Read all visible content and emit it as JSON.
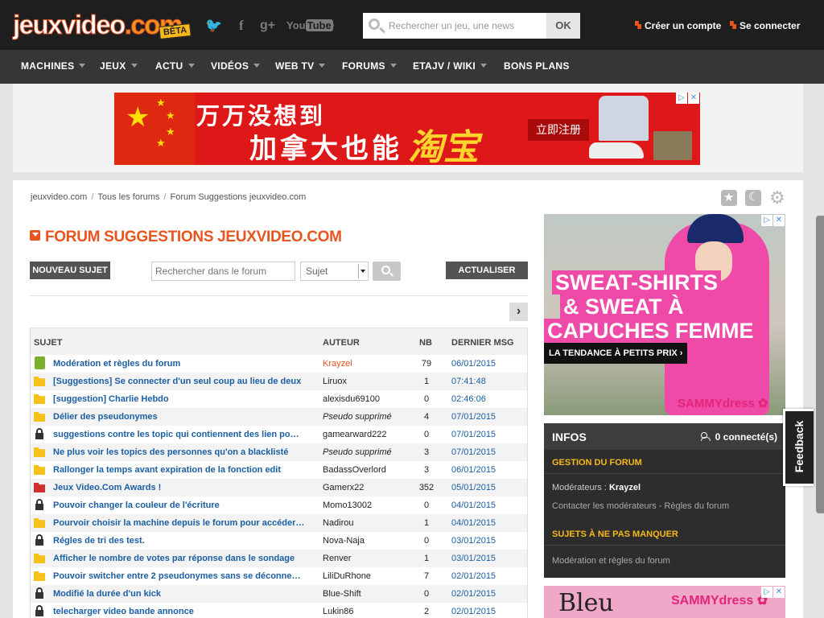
{
  "header": {
    "logo_main": "jeuxvideo",
    "logo_tld": ".com",
    "logo_badge": "BÊTA",
    "social": [
      {
        "icon": "twitter-icon",
        "glyph": "🐦"
      },
      {
        "icon": "facebook-icon",
        "glyph": "f"
      },
      {
        "icon": "googleplus-icon",
        "glyph": "g+"
      },
      {
        "icon": "youtube-icon",
        "glyph": "You"
      },
      {
        "icon": "rss-icon",
        "glyph": "◝"
      }
    ],
    "search_placeholder": "Rechercher un jeu, une news",
    "search_button": "OK",
    "create_account": "Créer un compte",
    "login": "Se connecter"
  },
  "nav": {
    "items": [
      {
        "label": "MACHINES",
        "dropdown": true
      },
      {
        "label": "JEUX",
        "dropdown": true
      },
      {
        "label": "ACTU",
        "dropdown": true
      },
      {
        "label": "VIDÉOS",
        "dropdown": true
      },
      {
        "label": "WEB TV",
        "dropdown": true
      },
      {
        "label": "FORUMS",
        "dropdown": true
      },
      {
        "label": "ETAJV / WIKI",
        "dropdown": true
      },
      {
        "label": "BONS PLANS",
        "dropdown": false
      }
    ]
  },
  "top_ad": {
    "line1": "万万没想到",
    "line2": "加拿大也能",
    "highlight": "淘宝",
    "button": "立即注册"
  },
  "breadcrumb": {
    "items": [
      "jeuxvideo.com",
      "Tous les forums",
      "Forum Suggestions jeuxvideo.com"
    ]
  },
  "forum": {
    "title": "FORUM SUGGESTIONS JEUXVIDEO.COM",
    "new_topic_button": "NOUVEAU SUJET",
    "search_placeholder": "Rechercher dans le forum",
    "search_scope": "Sujet",
    "refresh_button": "ACTUALISER",
    "next_page": "›",
    "columns": {
      "subject": "SUJET",
      "author": "AUTEUR",
      "count": "NB",
      "last": "DERNIER MSG"
    },
    "topics": [
      {
        "icon": "pin",
        "title": "Modération et règles du forum",
        "author": "Krayzel",
        "author_style": "mod",
        "count": "79",
        "last": "06/01/2015"
      },
      {
        "icon": "folder",
        "title": "[Suggestions] Se connecter d'un seul coup au lieu de deux",
        "author": "Liruox",
        "author_style": "normal",
        "count": "1",
        "last": "07:41:48"
      },
      {
        "icon": "folder",
        "title": "[suggestion] Charlie Hebdo",
        "author": "alexisdu69100",
        "author_style": "normal",
        "count": "0",
        "last": "02:46:06"
      },
      {
        "icon": "folder",
        "title": "Délier des pseudonymes",
        "author": "Pseudo supprimé",
        "author_style": "deleted",
        "count": "4",
        "last": "07/01/2015"
      },
      {
        "icon": "lock",
        "title": "suggestions contre les topic qui contiennent des lien po…",
        "author": "gamearward222",
        "author_style": "normal",
        "count": "0",
        "last": "07/01/2015"
      },
      {
        "icon": "folder",
        "title": "Ne plus voir les topics des personnes qu'on a blacklisté",
        "author": "Pseudo supprimé",
        "author_style": "deleted",
        "count": "3",
        "last": "07/01/2015"
      },
      {
        "icon": "folder",
        "title": "Rallonger la temps avant expiration de la fonction edit",
        "author": "BadassOverlord",
        "author_style": "normal",
        "count": "3",
        "last": "06/01/2015"
      },
      {
        "icon": "folderred",
        "title": "Jeux Video.Com Awards !",
        "author": "Gamerx22",
        "author_style": "normal",
        "count": "352",
        "last": "05/01/2015"
      },
      {
        "icon": "lock",
        "title": "Pouvoir changer la couleur de l'écriture",
        "author": "Momo13002",
        "author_style": "normal",
        "count": "0",
        "last": "04/01/2015"
      },
      {
        "icon": "folder",
        "title": "Pourvoir choisir la machine depuis le forum pour accéder…",
        "author": "Nadirou",
        "author_style": "normal",
        "count": "1",
        "last": "04/01/2015"
      },
      {
        "icon": "lock",
        "title": "Régles de tri des test.",
        "author": "Nova-Naja",
        "author_style": "normal",
        "count": "0",
        "last": "03/01/2015"
      },
      {
        "icon": "folder",
        "title": "Afficher le nombre de votes par réponse dans le sondage",
        "author": "Renver",
        "author_style": "normal",
        "count": "1",
        "last": "03/01/2015"
      },
      {
        "icon": "folder",
        "title": "Pouvoir switcher entre 2 pseudonymes sans se déconne…",
        "author": "LiliDuRhone",
        "author_style": "normal",
        "count": "7",
        "last": "02/01/2015"
      },
      {
        "icon": "lock",
        "title": "Modifié la durée d'un kick",
        "author": "Blue-Shift",
        "author_style": "normal",
        "count": "0",
        "last": "02/01/2015"
      },
      {
        "icon": "lock",
        "title": "telecharger video bande annonce",
        "author": "Lukin86",
        "author_style": "normal",
        "count": "2",
        "last": "02/01/2015"
      }
    ]
  },
  "side_ad": {
    "line1": "SWEAT-SHIRTS",
    "line2": "& SWEAT À",
    "line3": "CAPUCHES FEMME",
    "tagline": "LA TENDANCE À PETITS PRIX ›",
    "brand": "SAMMYdress ✿"
  },
  "infos": {
    "title": "INFOS",
    "connected": "0 connecté(s)",
    "manage_heading": "GESTION DU FORUM",
    "moderators_label": "Modérateurs :",
    "moderator": "Krayzel",
    "contact_link": "Contacter les modérateurs",
    "link_sep": " - ",
    "rules_link": "Règles du forum",
    "must_read_heading": "SUJETS À NE PAS MANQUER",
    "must_read_link": "Modération et règles du forum"
  },
  "bottom_ad": {
    "text": "Bleu",
    "brand": "SAMMYdress ✿"
  },
  "feedback": "Feedback",
  "colors": {
    "accent": "#e8541d",
    "link": "#1a5ea3",
    "topbar": "#1e1e1e",
    "navbar": "#363636",
    "section_heading": "#f8b81c"
  }
}
